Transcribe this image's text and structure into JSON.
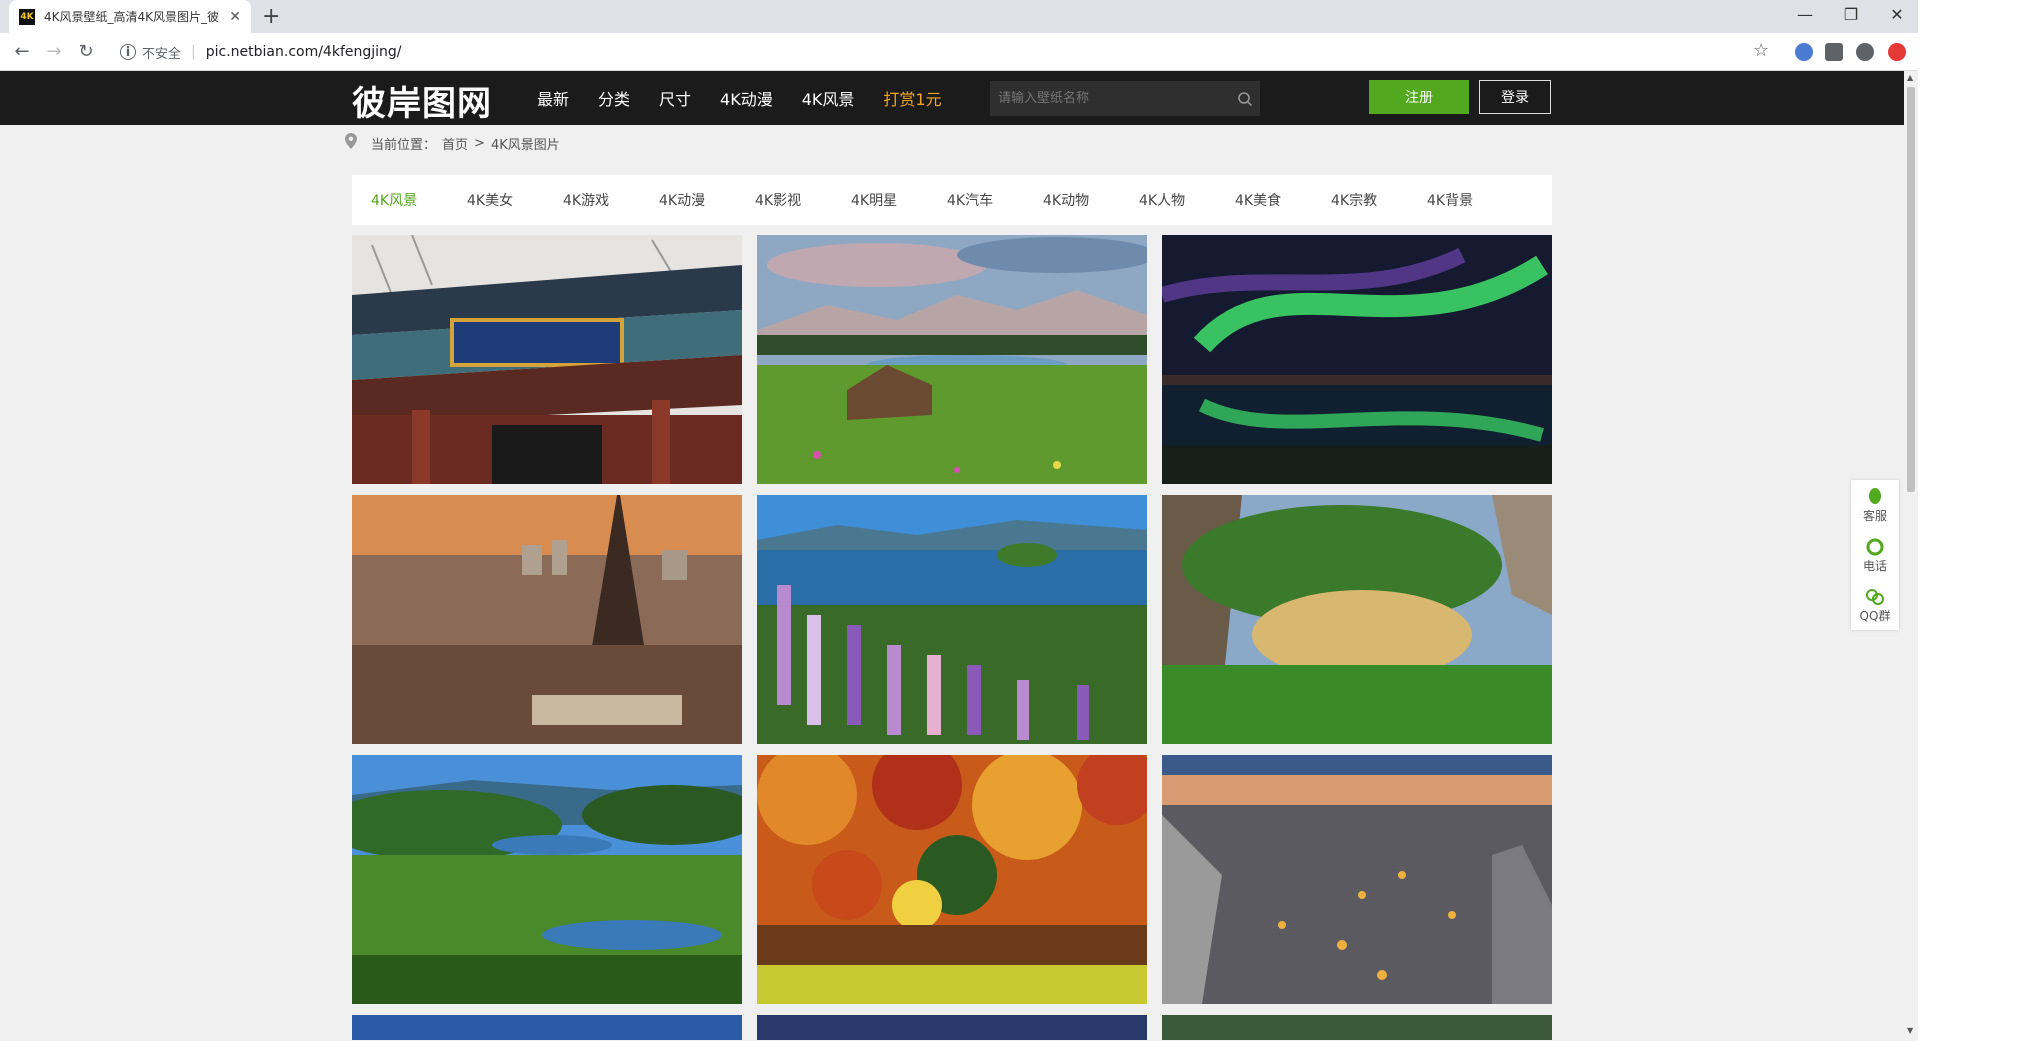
{
  "browser": {
    "tab_title": "4K风景壁纸_高清4K风景图片_彼",
    "favicon_text": "4K",
    "new_tab": "+",
    "insecure_label": "不安全",
    "url": "pic.netbian.com/4kfengjing/",
    "window_controls": {
      "minimize": "—",
      "restore": "❐",
      "close": "✕"
    }
  },
  "site": {
    "logo": "彼岸图网",
    "nav": [
      "最新",
      "分类",
      "尺寸",
      "4K动漫",
      "4K风景",
      "打赏1元"
    ],
    "search_placeholder": "请输入壁纸名称",
    "register": "注册",
    "login": "登录",
    "accent": "#52a81e",
    "gold": "#f5a623"
  },
  "breadcrumb": {
    "label": "当前位置：",
    "home": "首页",
    "sep": ">",
    "current": "4K风景图片"
  },
  "categories": [
    "4K风景",
    "4K美女",
    "4K游戏",
    "4K动漫",
    "4K影视",
    "4K明星",
    "4K汽车",
    "4K动物",
    "4K人物",
    "4K美食",
    "4K宗教",
    "4K背景"
  ],
  "thumbnails": [
    {
      "name": "peking-university-gate"
    },
    {
      "name": "alpine-meadow-hut"
    },
    {
      "name": "aurora-over-lake"
    },
    {
      "name": "eiffel-tower-paris"
    },
    {
      "name": "lupine-flowers-lake"
    },
    {
      "name": "zhangjiajie-cliff"
    },
    {
      "name": "river-valley-forest"
    },
    {
      "name": "autumn-forest-reflection"
    },
    {
      "name": "cappadocia-night"
    },
    {
      "name": "partial-row-1"
    },
    {
      "name": "partial-row-2"
    },
    {
      "name": "partial-row-3"
    }
  ],
  "side_panel": [
    "客服",
    "电话",
    "QQ群"
  ]
}
